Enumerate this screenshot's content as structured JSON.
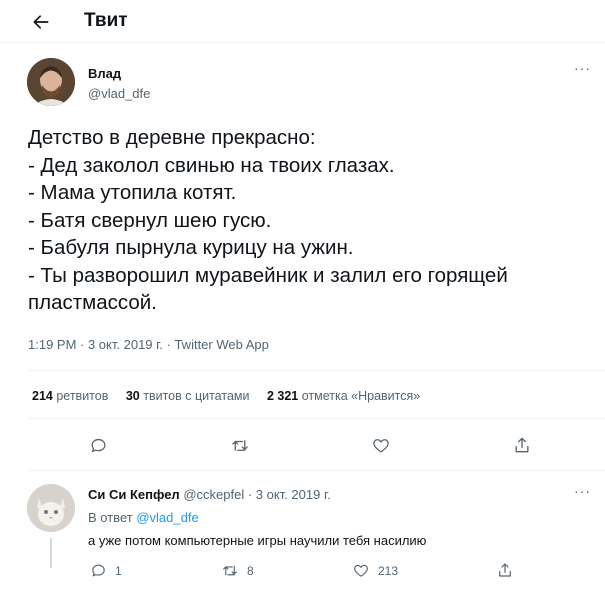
{
  "header": {
    "title": "Твит",
    "back_icon": "arrow-left-icon"
  },
  "tweet": {
    "author_name": "Влад",
    "author_handle": "@vlad_dfe",
    "more_icon": "more-icon",
    "more_label": "···",
    "lines": [
      "Детство в деревне прекрасно:",
      "- Дед заколол свинью на твоих глазах.",
      "- Мама утопила котят.",
      "- Батя свернул шею гусю.",
      "- Бабуля пырнула курицу на ужин.",
      "- Ты разворошил муравейник и залил его горящей",
      "пластмассой."
    ],
    "meta": "1:19 PM · 3 окт. 2019 г. · Twitter Web App",
    "stats": {
      "retweets_count": "214",
      "retweets_label": "ретвитов",
      "quotes_count": "30",
      "quotes_label": "твитов с цитатами",
      "likes_count": "2 321",
      "likes_label": "отметка «Нравится»"
    },
    "actions": [
      "reply-icon",
      "retweet-icon",
      "like-icon",
      "share-icon"
    ]
  },
  "reply": {
    "author_name": "Си Си Кепфел",
    "author_handle": "@cckepfel",
    "separator": " · ",
    "date": "3 окт. 2019 г.",
    "reply_to_label": "В ответ",
    "reply_to_handle": "@vlad_dfe",
    "text": "а уже потом компьютерные игры научили тебя насилию",
    "more_label": "···",
    "counts": {
      "replies": "1",
      "retweets": "8",
      "likes": "213"
    }
  },
  "colors": {
    "accent": "#1d9bf0",
    "muted": "#536471",
    "text": "#0f1419",
    "divider": "#eff3f4"
  }
}
